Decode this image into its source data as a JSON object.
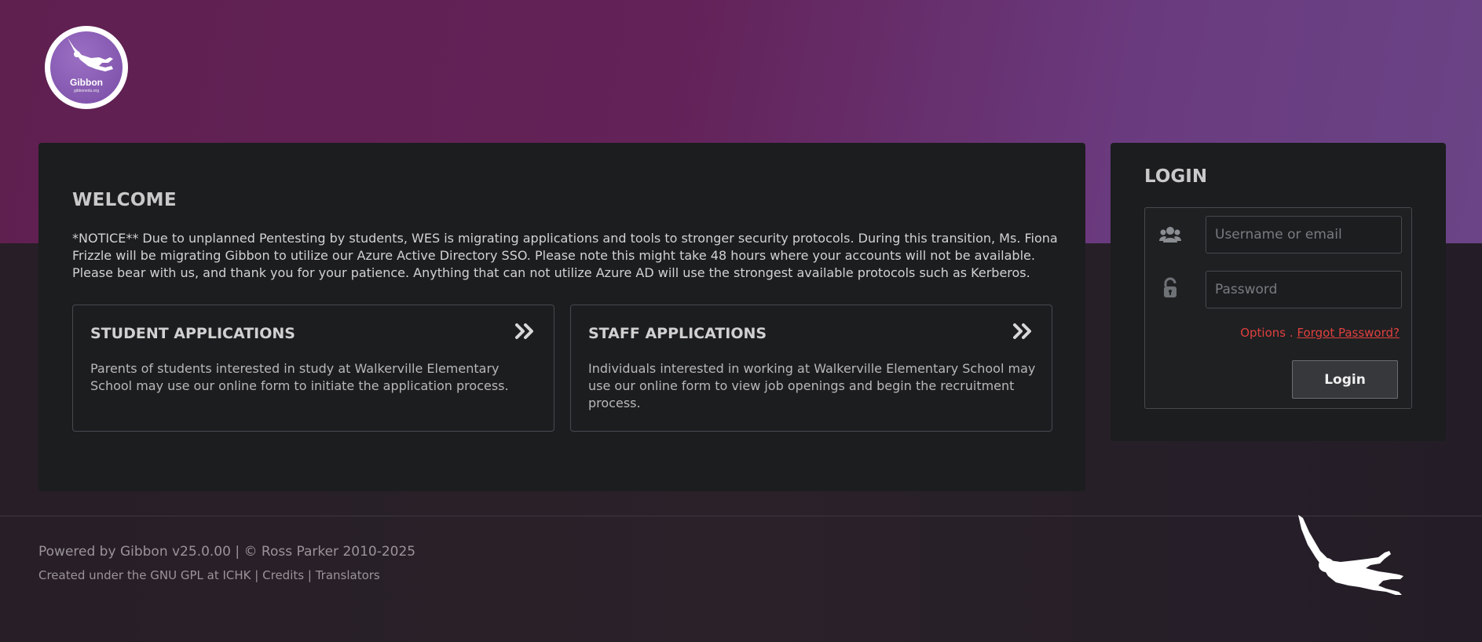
{
  "logo": {
    "name": "Gibbon",
    "url": "gibbonedu.org"
  },
  "welcome": {
    "title": "WELCOME",
    "notice": "*NOTICE** Due to unplanned Pentesting by students, WES is migrating applications and tools to stronger security protocols. During this transition, Ms. Fiona Frizzle will be migrating Gibbon to utilize our Azure Active Directory SSO. Please note this might take 48 hours where your accounts will not be available. Please bear with us, and thank you for your patience. Anything that can not utilize Azure AD will use the strongest available protocols such as Kerberos."
  },
  "applications": [
    {
      "title": "STUDENT APPLICATIONS",
      "description": "Parents of students interested in study at Walkerville Elementary School may use our online form to initiate the application process."
    },
    {
      "title": "STAFF APPLICATIONS",
      "description": "Individuals interested in working at Walkerville Elementary School may use our online form to view job openings and begin the recruitment process."
    }
  ],
  "login": {
    "title": "LOGIN",
    "username_placeholder": "Username or email",
    "username_value": "",
    "password_placeholder": "Password",
    "password_value": "",
    "options_label": "Options",
    "separator": ".",
    "forgot_label": "Forgot Password?",
    "button_label": "Login"
  },
  "footer": {
    "powered_prefix": "Powered by",
    "gibbon_version": "Gibbon v25.0.00",
    "copyright": "| © Ross Parker 2010-2025",
    "created_prefix": "Created under the",
    "gpl": "GNU GPL",
    "at": "at",
    "ichk": "ICHK",
    "sep1": "|",
    "credits": "Credits",
    "sep2": "|",
    "translators": "Translators"
  },
  "colors": {
    "accent_link": "#e0403e",
    "banner_start": "#5f2050",
    "banner_end": "#6a4486",
    "panel_bg": "#1c1d1f"
  },
  "icons": {
    "users": "users-icon",
    "lock": "lock-icon",
    "chevrons": "double-chevron-right-icon"
  }
}
